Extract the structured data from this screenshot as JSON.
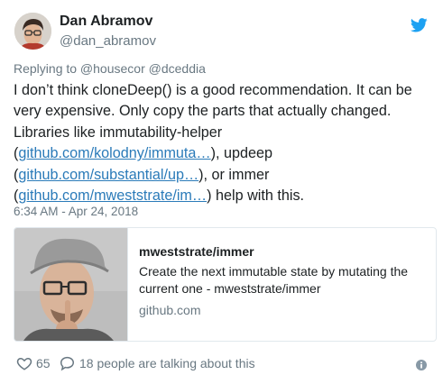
{
  "author": {
    "name": "Dan Abramov",
    "handle": "@dan_abramov"
  },
  "icons": {
    "brand": "twitter-bird-icon",
    "like": "heart-icon",
    "reply": "speech-bubble-icon",
    "info": "info-icon"
  },
  "colors": {
    "twitter_blue": "#1da1f2",
    "link": "#2b7bb9",
    "text": "#1c2022",
    "secondary": "#697882",
    "border": "#e1e8ed"
  },
  "tweet": {
    "replying_to": "Replying to @housecor @dceddia",
    "lines": [
      "I don’t think cloneDeep() is a good recommendation. It can be",
      "very expensive. Only copy the parts that actually changed.",
      "Libraries like immutability-helper"
    ],
    "link1_prefix": "(",
    "link1_text": "github.com/kolodny/immuta…",
    "link1_suffix": "), updeep",
    "link2_prefix": "(",
    "link2_text": "github.com/substantial/up…",
    "link2_suffix": "), or immer",
    "link3_prefix": "(",
    "link3_text": "github.com/mweststrate/im…",
    "link3_suffix": ") help with this.",
    "timestamp": "6:34 AM - Apr 24, 2018"
  },
  "card": {
    "title": "mweststrate/immer",
    "description": "Create the next immutable state by mutating the current one - mweststrate/immer",
    "domain": "github.com"
  },
  "actions": {
    "likes": "65",
    "talking": "18 people are talking about this"
  }
}
